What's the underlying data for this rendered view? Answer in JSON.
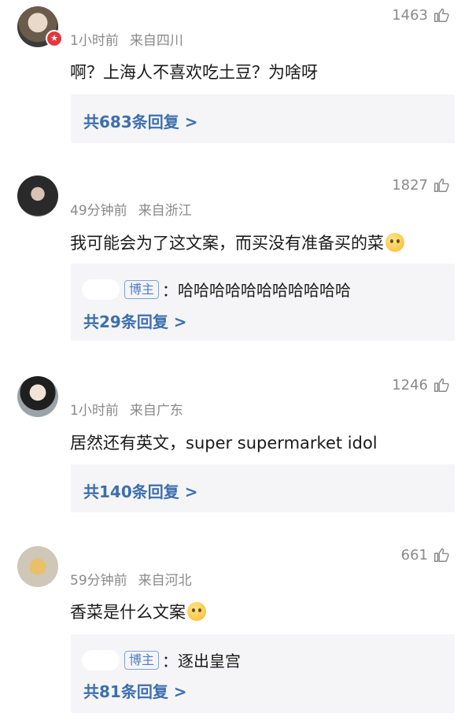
{
  "comments": [
    {
      "time": "1小时前",
      "location": "来自四川",
      "likes": "1463",
      "text": "啊？上海人不喜欢吃土豆？为啥呀",
      "reply_count_label": "共683条回复 >"
    },
    {
      "time": "49分钟前",
      "location": "来自浙江",
      "likes": "1827",
      "text": "我可能会为了这文案，而买没有准备买的菜",
      "author_badge": "博主",
      "author_reply": "：哈哈哈哈哈哈哈哈哈哈哈",
      "reply_count_label": "共29条回复 >"
    },
    {
      "time": "1小时前",
      "location": "来自广东",
      "likes": "1246",
      "text": "居然还有英文，super supermarket idol",
      "reply_count_label": "共140条回复 >"
    },
    {
      "time": "59分钟前",
      "location": "来自河北",
      "likes": "661",
      "text": "香菜是什么文案",
      "author_badge": "博主",
      "author_reply": "：逐出皇宫",
      "reply_count_label": "共81条回复 >"
    }
  ],
  "colors": {
    "meta_gray": "#8a8a8a",
    "link_blue": "#3c6fae",
    "reply_bg": "#f5f5f7",
    "badge_blue": "#4f7ec2"
  }
}
